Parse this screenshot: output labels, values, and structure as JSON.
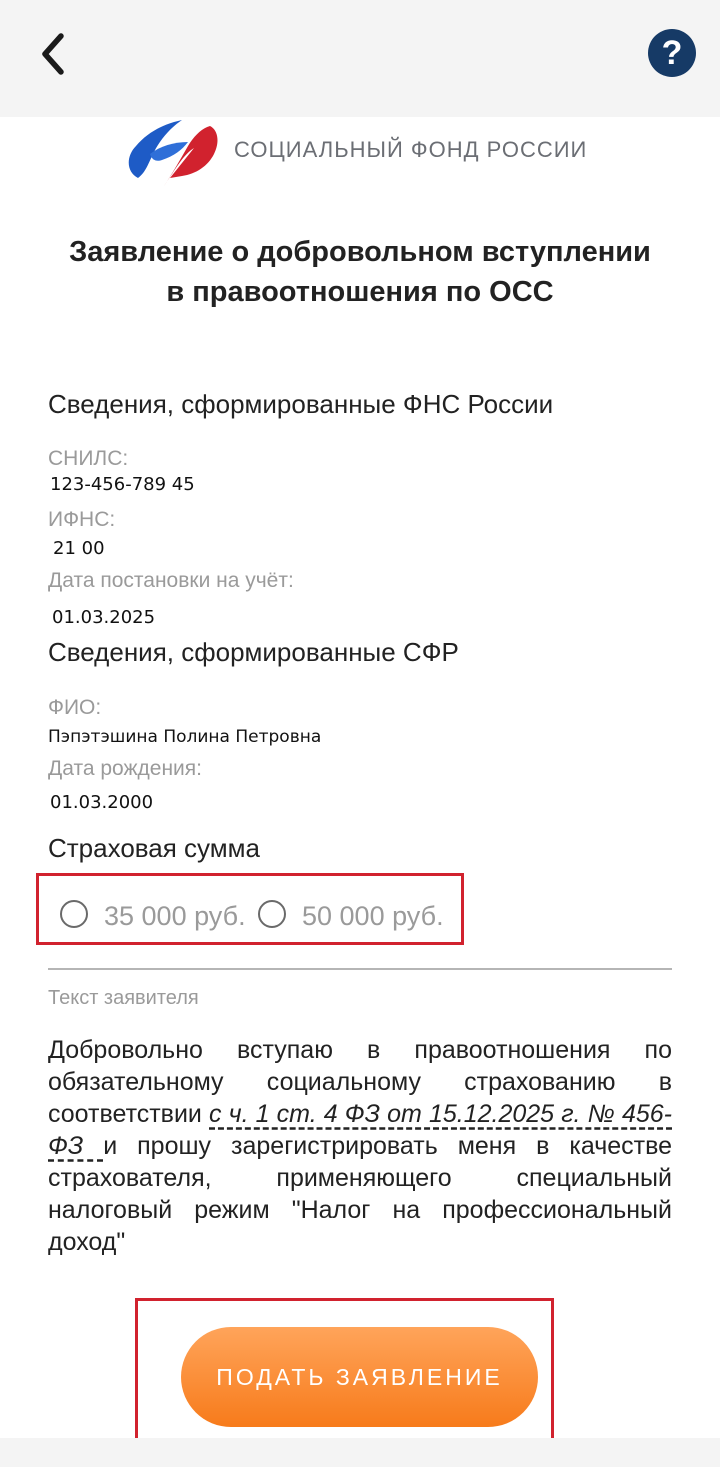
{
  "header": {
    "back_icon": "chevron-left-icon",
    "help_label": "?",
    "help_icon": "question-icon"
  },
  "brand": {
    "logo_text": "СОЦИАЛЬНЫЙ ФОНД РОССИИ",
    "logo_colors": [
      "#1e5bc6",
      "#d1222e"
    ]
  },
  "title": "Заявление о добровольном вступлении в правоотношения по ОСС",
  "fns": {
    "heading": "Сведения, сформированные ФНС России",
    "snils_label": "СНИЛС:",
    "snils_value": "123-456-789 45",
    "ifns_label": "ИФНС:",
    "ifns_value": "21 00",
    "reg_date_label": "Дата постановки на учёт:",
    "reg_date_value": "01.03.2025"
  },
  "sfr": {
    "heading": "Сведения, сформированные СФР",
    "fio_label": "ФИО:",
    "fio_value": "Пэпэтэшина Полина Петровна",
    "birth_label": "Дата рождения:",
    "birth_value": "01.03.2000"
  },
  "insurance": {
    "heading": "Страховая сумма",
    "options": [
      {
        "label": "35 000 руб.",
        "selected": false
      },
      {
        "label": "50 000 руб.",
        "selected": false
      }
    ]
  },
  "statement": {
    "label": "Текст заявителя",
    "text_before": "Добровольно вступаю в правоотношения по обязательному социальному страхованию в соответствии ",
    "law_link": "с ч. 1 ст. 4 ФЗ от 15.12.2025 г. № 456-ФЗ ",
    "text_after": "и прошу зарегистрировать меня в качестве страхователя, применяющего специальный налоговый режим \"Налог на профессиональный доход\""
  },
  "submit": {
    "label": "ПОДАТЬ ЗАЯВЛЕНИЕ"
  },
  "colors": {
    "accent_orange": "#f77b1b",
    "highlight_red": "#d1222e",
    "help_navy": "#163a66"
  }
}
